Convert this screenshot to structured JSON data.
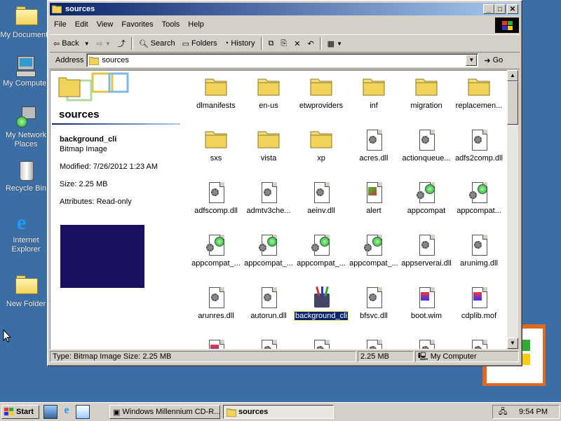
{
  "desktop": {
    "icons": [
      {
        "label": "My Documents"
      },
      {
        "label": "My Computer"
      },
      {
        "label": "My Network Places"
      },
      {
        "label": "Recycle Bin"
      },
      {
        "label": "Internet Explorer"
      },
      {
        "label": "New Folder"
      }
    ]
  },
  "window": {
    "title": "sources",
    "menu": [
      "File",
      "Edit",
      "View",
      "Favorites",
      "Tools",
      "Help"
    ],
    "toolbar": {
      "back": "Back",
      "search": "Search",
      "folders": "Folders",
      "history": "History"
    },
    "address": {
      "label": "Address",
      "value": "sources",
      "go": "Go"
    },
    "details": {
      "folder_title": "sources",
      "name": "background_cli",
      "type": "Bitmap Image",
      "modified": "Modified: 7/26/2012 1:23 AM",
      "size": "Size: 2.25 MB",
      "attributes": "Attributes: Read-only"
    },
    "files": [
      {
        "name": "dlmanifests",
        "kind": "folder"
      },
      {
        "name": "en-us",
        "kind": "folder"
      },
      {
        "name": "etwproviders",
        "kind": "folder"
      },
      {
        "name": "inf",
        "kind": "folder"
      },
      {
        "name": "migration",
        "kind": "folder"
      },
      {
        "name": "replacemen...",
        "kind": "folder"
      },
      {
        "name": "sxs",
        "kind": "folder"
      },
      {
        "name": "vista",
        "kind": "folder"
      },
      {
        "name": "xp",
        "kind": "folder"
      },
      {
        "name": "acres.dll",
        "kind": "dll"
      },
      {
        "name": "actionqueue...",
        "kind": "dll"
      },
      {
        "name": "adfs2comp.dll",
        "kind": "dll"
      },
      {
        "name": "adfscomp.dll",
        "kind": "dll"
      },
      {
        "name": "admtv3che...",
        "kind": "dll"
      },
      {
        "name": "aeinv.dll",
        "kind": "dll"
      },
      {
        "name": "alert",
        "kind": "alert"
      },
      {
        "name": "appcompat",
        "kind": "appcompat"
      },
      {
        "name": "appcompat...",
        "kind": "appcompat"
      },
      {
        "name": "appcompat_...",
        "kind": "appcompat"
      },
      {
        "name": "appcompat_...",
        "kind": "appcompat"
      },
      {
        "name": "appcompat_...",
        "kind": "appcompat"
      },
      {
        "name": "appcompat_...",
        "kind": "appcompat"
      },
      {
        "name": "appserverai.dll",
        "kind": "dll"
      },
      {
        "name": "arunimg.dll",
        "kind": "dll"
      },
      {
        "name": "arunres.dll",
        "kind": "dll"
      },
      {
        "name": "autorun.dll",
        "kind": "dll"
      },
      {
        "name": "background_cli",
        "kind": "bitmap",
        "selected": true
      },
      {
        "name": "bfsvc.dll",
        "kind": "dll"
      },
      {
        "name": "boot.wim",
        "kind": "wim"
      },
      {
        "name": "cdplib.mof",
        "kind": "wim"
      },
      {
        "name": "",
        "kind": "wim"
      },
      {
        "name": "",
        "kind": "dll"
      },
      {
        "name": "",
        "kind": "dll"
      },
      {
        "name": "",
        "kind": "dll"
      },
      {
        "name": "",
        "kind": "dll"
      },
      {
        "name": "",
        "kind": "dll"
      }
    ],
    "status": {
      "info": "Type: Bitmap Image Size: 2.25 MB",
      "size": "2.25 MB",
      "zone": "My Computer"
    }
  },
  "taskbar": {
    "start": "Start",
    "tasks": [
      {
        "label": "Windows Millennium CD-R..."
      },
      {
        "label": "sources",
        "active": true
      }
    ],
    "clock": "9:54 PM"
  },
  "colors": {
    "desktop": "#3b6ea5",
    "title_start": "#0a246a",
    "title_end": "#a6caf0",
    "preview": "#1a1060"
  }
}
